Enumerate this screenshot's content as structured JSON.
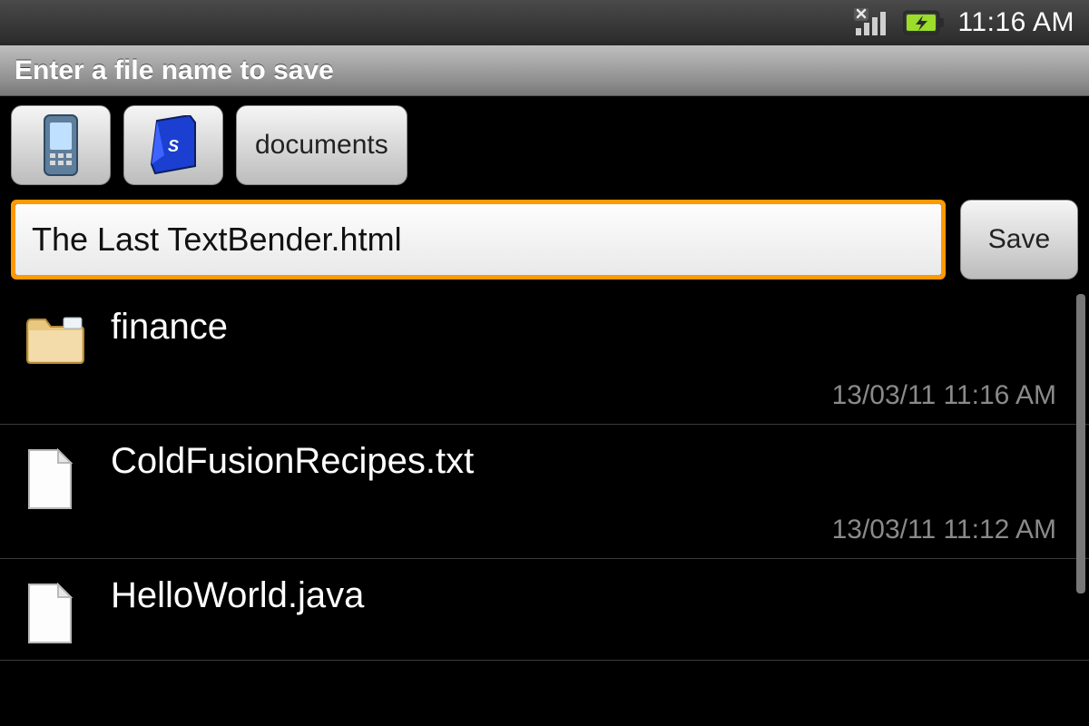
{
  "status": {
    "clock": "11:16 AM"
  },
  "dialog": {
    "title": "Enter a file name to save",
    "filename_value": "The Last TextBender.html",
    "save_label": "Save",
    "path": {
      "folder_label": "documents"
    }
  },
  "files": [
    {
      "type": "folder",
      "name": "finance",
      "modified": "13/03/11 11:16 AM"
    },
    {
      "type": "file",
      "name": "ColdFusionRecipes.txt",
      "modified": "13/03/11 11:12 AM"
    },
    {
      "type": "file",
      "name": "HelloWorld.java",
      "modified": ""
    }
  ]
}
